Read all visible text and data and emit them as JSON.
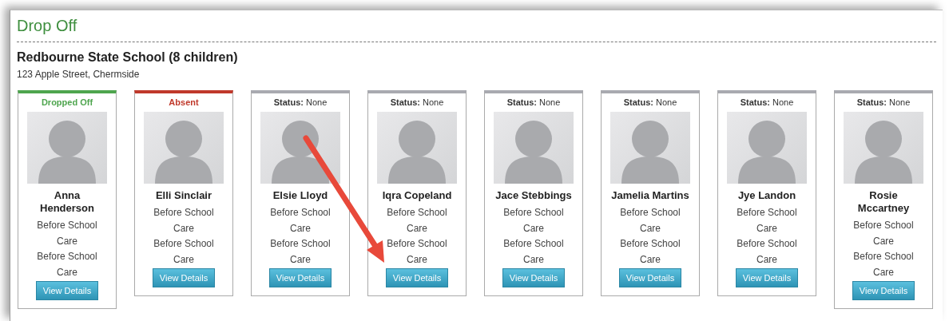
{
  "page": {
    "title": "Drop Off"
  },
  "school": {
    "name": "Redbourne State School (8 children)",
    "address": "123 Apple Street, Chermside"
  },
  "children": [
    {
      "kind": "dropped_off",
      "status_text": "Dropped Off",
      "name": "Anna Henderson",
      "sessions": [
        "Before School Care",
        "Before School Care"
      ],
      "button": "View Details"
    },
    {
      "kind": "absent",
      "status_text": "Absent",
      "name": "Elli Sinclair",
      "sessions": [
        "Before School Care",
        "Before School Care"
      ],
      "button": "View Details"
    },
    {
      "kind": "none",
      "status_text": "**Status:** None",
      "name": "Elsie Lloyd",
      "sessions": [
        "Before School Care",
        "Before School Care"
      ],
      "button": "View Details"
    },
    {
      "kind": "none",
      "status_text": "**Status:** None",
      "name": "Iqra Copeland",
      "sessions": [
        "Before School Care",
        "Before School Care"
      ],
      "button": "View Details"
    },
    {
      "kind": "none",
      "status_text": "**Status:** None",
      "name": "Jace Stebbings",
      "sessions": [
        "Before School Care",
        "Before School Care"
      ],
      "button": "View Details"
    },
    {
      "kind": "none",
      "status_text": "**Status:** None",
      "name": "Jamelia Martins",
      "sessions": [
        "Before School Care",
        "Before School Care"
      ],
      "button": "View Details"
    },
    {
      "kind": "none",
      "status_text": "**Status:** None",
      "name": "Jye Landon",
      "sessions": [
        "Before School Care",
        "Before School Care"
      ],
      "button": "View Details"
    },
    {
      "kind": "none",
      "status_text": "**Status:** None",
      "name": "Rosie Mccartney",
      "sessions": [
        "Before School Care",
        "Before School Care"
      ],
      "button": "View Details"
    }
  ]
}
